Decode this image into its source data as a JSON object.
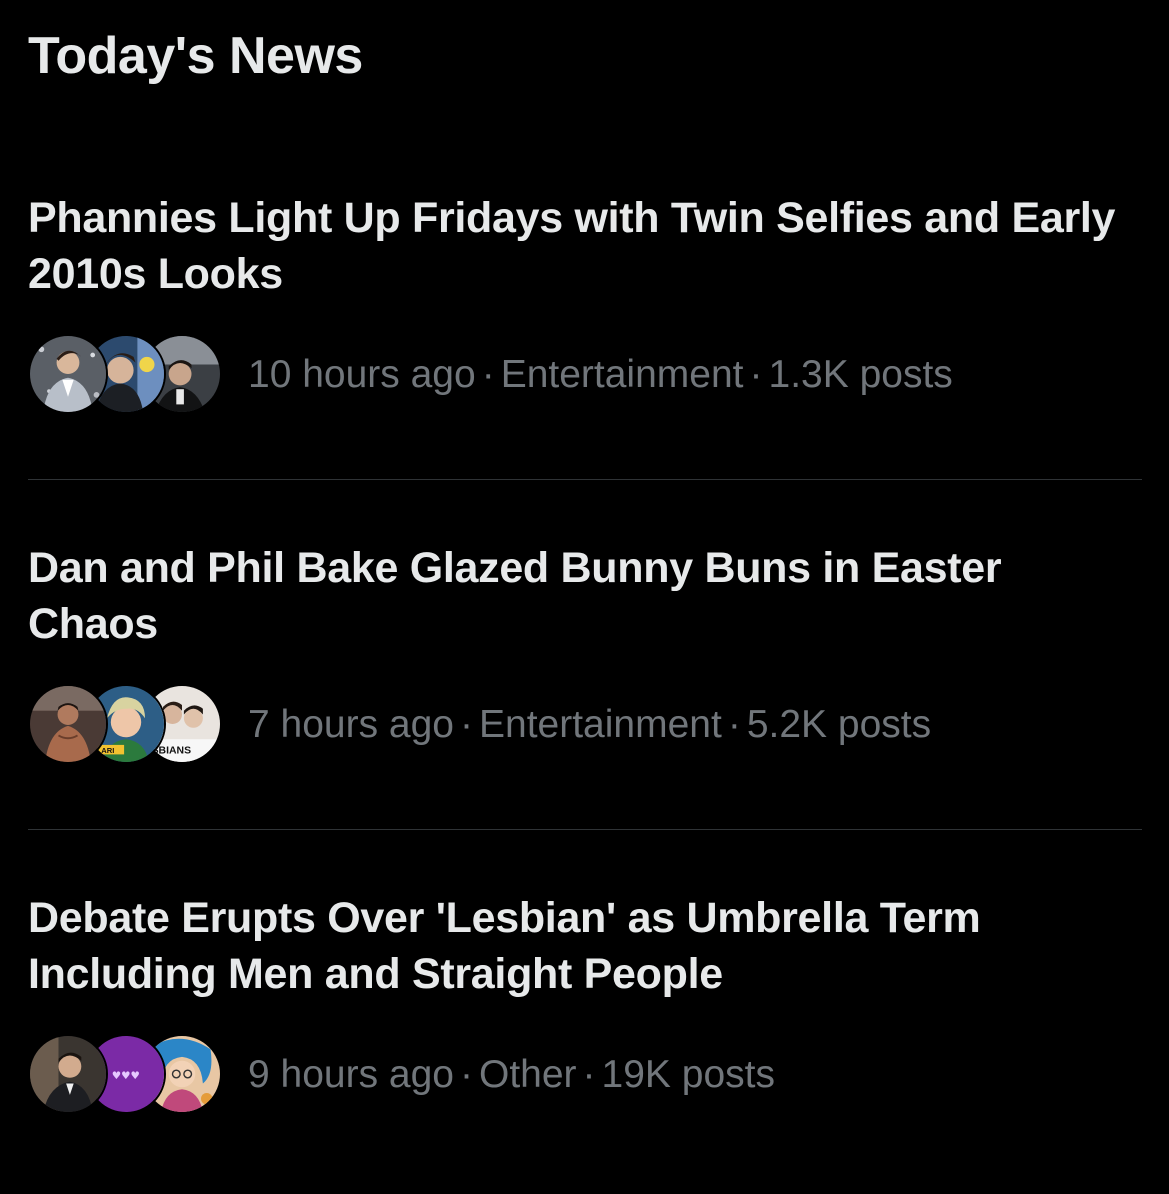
{
  "section": {
    "title": "Today's News"
  },
  "items": [
    {
      "headline": "Phannies Light Up Fridays with Twin Selfies and Early 2010s Looks",
      "time": "10 hours ago",
      "category": "Entertainment",
      "posts": "1.3K posts",
      "separator": "·"
    },
    {
      "headline": "Dan and Phil Bake Glazed Bunny Buns in Easter Chaos",
      "time": "7 hours ago",
      "category": "Entertainment",
      "posts": "5.2K posts",
      "separator": "·",
      "avatar_captions": [
        "ARI",
        "SBIANS"
      ]
    },
    {
      "headline": "Debate Erupts Over 'Lesbian' as Umbrella Term Including Men and Straight People",
      "time": "9 hours ago",
      "category": "Other",
      "posts": "19K posts",
      "separator": "·",
      "avatar_captions": [
        "♥♥♥"
      ]
    }
  ],
  "colors": {
    "background": "#000000",
    "headline": "#e7e9ea",
    "meta": "#71767b",
    "divider": "#2f3336",
    "purple_avatar": "#7b2aa6"
  }
}
